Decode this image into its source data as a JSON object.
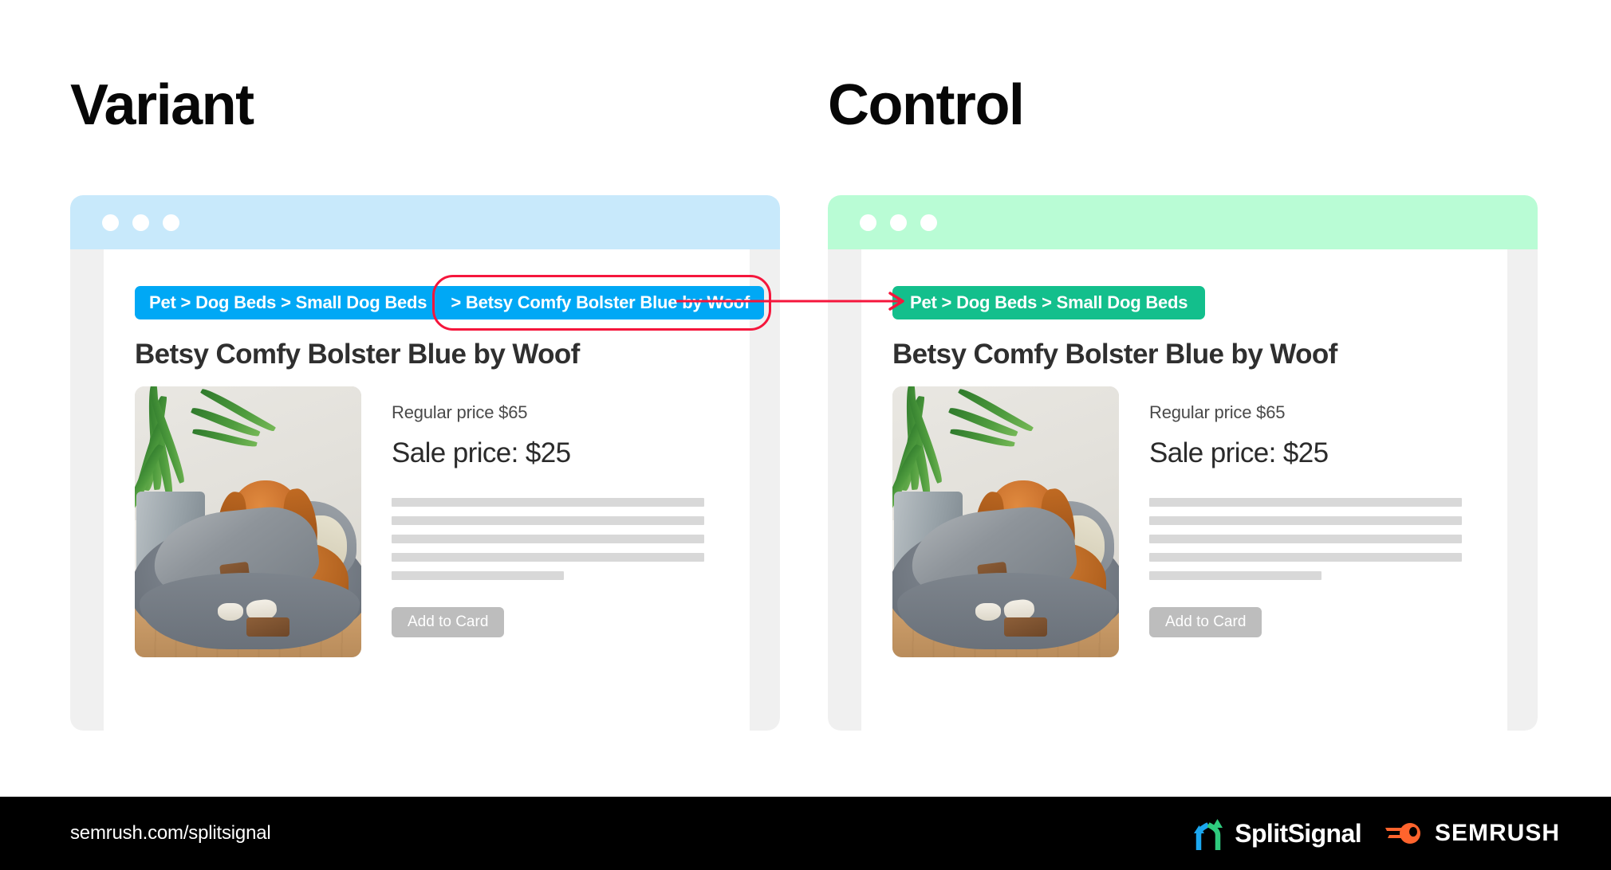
{
  "headings": {
    "variant": "Variant",
    "control": "Control"
  },
  "colors": {
    "variant_bar": "#C8E9FB",
    "control_bar": "#B9FCD5",
    "variant_pill": "#00A8F5",
    "control_pill": "#13BF8C",
    "highlight": "#F5163C",
    "button": "#BDBDBD",
    "skeleton": "#D8D8D8",
    "footer": "#000000",
    "splitsignal_blue": "#1BA7F0",
    "splitsignal_green": "#2FCB7E",
    "semrush_orange": "#FF642D"
  },
  "variant": {
    "window_dots": [
      "dot-1",
      "dot-2",
      "dot-3"
    ],
    "breadcrumb_main": "Pet > Dog Beds > Small Dog Beds",
    "breadcrumb_tail": "> Betsy Comfy Bolster Blue by Woof",
    "product_title": "Betsy Comfy Bolster Blue by Woof",
    "regular_price": "Regular price $65",
    "sale_price": "Sale price: $25",
    "add_button": "Add to Card",
    "photo_alt": "dog-in-grey-bolster-bed-photo",
    "skeleton_widths": [
      "100%",
      "100%",
      "100%",
      "100%",
      "55%"
    ]
  },
  "control": {
    "window_dots": [
      "dot-1",
      "dot-2",
      "dot-3"
    ],
    "breadcrumb_main": "Pet > Dog Beds > Small Dog Beds",
    "product_title": "Betsy Comfy Bolster Blue by Woof",
    "regular_price": "Regular price $65",
    "sale_price": "Sale price: $25",
    "add_button": "Add to Card",
    "photo_alt": "dog-in-grey-bolster-bed-photo",
    "skeleton_widths": [
      "100%",
      "100%",
      "100%",
      "100%",
      "55%"
    ]
  },
  "footer": {
    "url": "semrush.com/splitsignal",
    "splitsignal_label": "SplitSignal",
    "semrush_label": "SEMRUSH"
  }
}
